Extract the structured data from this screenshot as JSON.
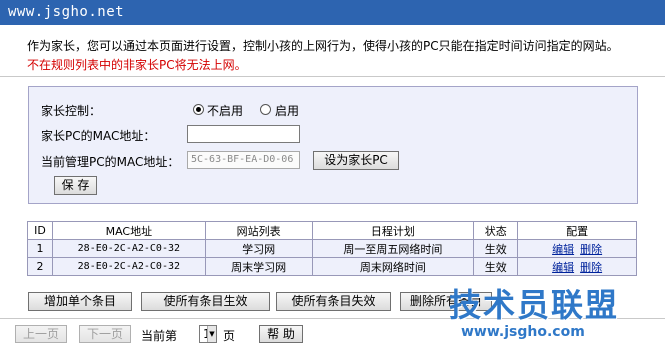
{
  "window": {
    "title": "www.jsgho.net"
  },
  "description": {
    "line1": "作为家长，您可以通过本页面进行设置，控制小孩的上网行为，使得小孩的PC只能在指定时间访问指定的网站。",
    "line2": "不在规则列表中的非家长PC将无法上网。"
  },
  "form": {
    "parental_control_label": "家长控制：",
    "option_off": "不启用",
    "option_on": "启用",
    "selected": "off",
    "parent_mac_label": "家长PC的MAC地址：",
    "parent_mac_value": "",
    "current_mac_label": "当前管理PC的MAC地址：",
    "current_mac_value": "5C-63-BF-EA-D0-06",
    "set_parent_button": "设为家长PC",
    "save_button": "保 存"
  },
  "table": {
    "headers": [
      "ID",
      "MAC地址",
      "网站列表",
      "日程计划",
      "状态",
      "配置"
    ],
    "rows": [
      {
        "id": "1",
        "mac": "28-E0-2C-A2-C0-32",
        "sites": "学习网",
        "schedule": "周一至周五网络时间",
        "status": "生效",
        "edit": "编辑",
        "delete": "删除"
      },
      {
        "id": "2",
        "mac": "28-E0-2C-A2-C0-32",
        "sites": "周末学习网",
        "schedule": "周末网络时间",
        "status": "生效",
        "edit": "编辑",
        "delete": "删除"
      }
    ]
  },
  "actions": {
    "add": "增加单个条目",
    "enable_all": "使所有条目生效",
    "disable_all": "使所有条目失效",
    "delete_all": "删除所有条目"
  },
  "pagination": {
    "prev": "上一页",
    "next": "下一页",
    "current_label": "当前第",
    "page": "1",
    "page_unit": "页",
    "help": "帮 助"
  },
  "watermark": {
    "title": "技术员联盟",
    "url": "www.jsgho.com"
  },
  "colors": {
    "titlebar": "#2d64b0",
    "panel_bg": "#eef0fb",
    "warning_text": "#d40000",
    "link": "#00239c",
    "watermark": "#2f78c8"
  }
}
